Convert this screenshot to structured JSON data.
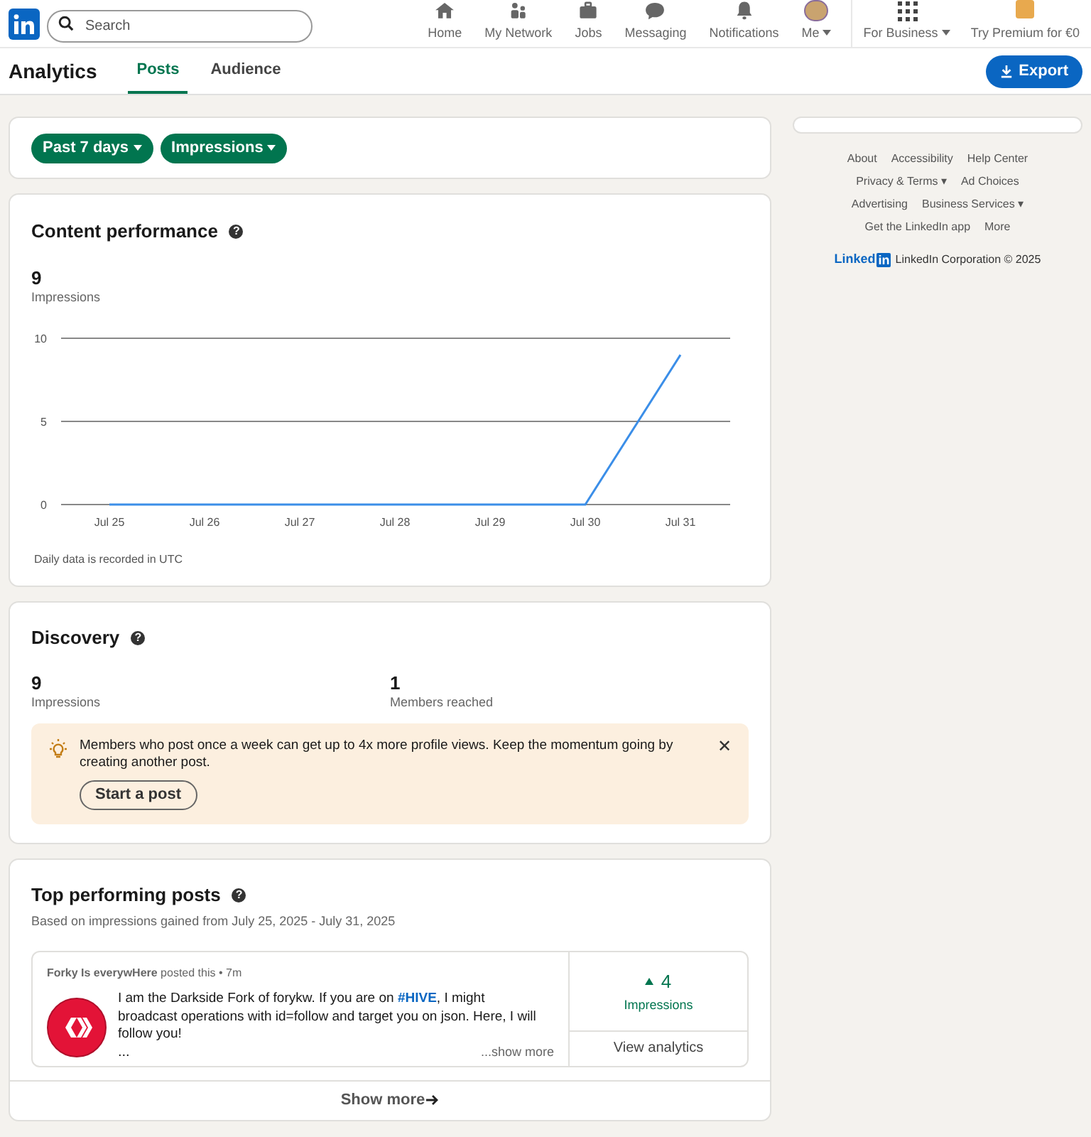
{
  "nav": {
    "search": {
      "placeholder": "Search"
    },
    "items": [
      {
        "kind": "home",
        "label": "Home",
        "selected": false
      },
      {
        "kind": "network",
        "label": "My Network",
        "selected": false
      },
      {
        "kind": "jobs",
        "label": "Jobs",
        "selected": false
      },
      {
        "kind": "messaging",
        "label": "Messaging",
        "selected": false
      },
      {
        "kind": "notifications",
        "label": "Notifications",
        "selected": false
      },
      {
        "kind": "me",
        "label": "Me",
        "selected": false
      }
    ],
    "business": "For Business",
    "premium": "Try Premium for €0"
  },
  "header": {
    "title": "Analytics",
    "tabs": [
      {
        "label": "Posts",
        "selected": true
      },
      {
        "label": "Audience",
        "selected": false
      }
    ],
    "export": "Export"
  },
  "filters": [
    "Past 7 days",
    "Impressions"
  ],
  "content_performance": {
    "title": "Content performance",
    "help": "?",
    "value": "9",
    "label": "Impressions",
    "chart_data": {
      "type": "line",
      "categories": [
        "Jul 25",
        "Jul 26",
        "Jul 27",
        "Jul 28",
        "Jul 29",
        "Jul 30",
        "Jul 31"
      ],
      "values": [
        0,
        0,
        0,
        0,
        0,
        0,
        9
      ],
      "ylim": [
        0,
        10
      ],
      "yticks": [
        0,
        5,
        10
      ]
    },
    "note": "Daily data is recorded in UTC"
  },
  "discovery": {
    "title": "Discovery",
    "help": "?",
    "stats": [
      {
        "value": "9",
        "label": "Impressions"
      },
      {
        "value": "1",
        "label": "Members reached"
      }
    ],
    "tip": {
      "text": "Members who post once a week can get up to 4x more profile views. Keep the momentum going by creating another post.",
      "button": "Start a post",
      "close": "✕"
    }
  },
  "top_posts": {
    "title": "Top performing posts",
    "help": "?",
    "subtitle": "Based on impressions gained from July 25, 2025 - July 31, 2025",
    "posts": [
      {
        "author": "Forky Is everywHere",
        "meta": "posted this • 7m",
        "text_before": "I am the Darkside Fork of forykw. If you are on ",
        "hashtag": "#HIVE",
        "text_after": ", I might broadcast operations with id=follow and target you on json. Here, I will follow you!",
        "ellipsis": "...",
        "show_more": "...show more",
        "count": "4",
        "count_label": "Impressions",
        "view": "View analytics"
      }
    ],
    "show_more": "Show more"
  },
  "footer": {
    "links": [
      [
        "About",
        "Accessibility",
        "Help Center"
      ],
      [
        "Privacy & Terms ▾",
        "Ad Choices"
      ],
      [
        "Advertising",
        "Business Services ▾"
      ],
      [
        "Get the LinkedIn app",
        "More"
      ]
    ],
    "logo_word": "Linked",
    "logo_in": "in",
    "copyright": "LinkedIn Corporation © 2025"
  }
}
